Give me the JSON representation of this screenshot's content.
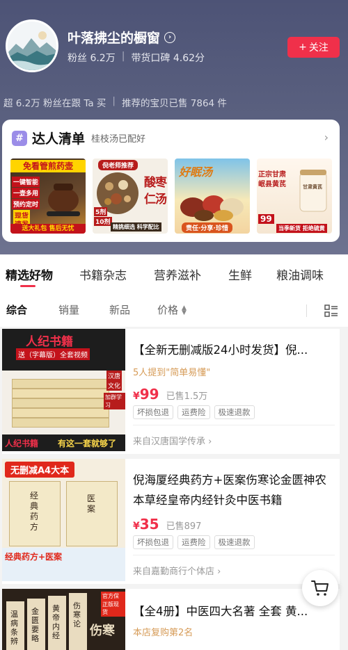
{
  "shop": {
    "name": "叶落拂尘的橱窗",
    "fans": "粉丝 6.2万",
    "rating": "带货口碑 4.62分",
    "follow_label": "关注",
    "stats_left": "超 6.2万 粉丝在跟 Ta 买",
    "stats_right": "推荐的宝贝已售 7864 件"
  },
  "curated": {
    "title": "达人清单",
    "subtitle": "桂枝汤已配好",
    "thumbs": [
      {
        "texts": [
          "免看管煎药壶",
          "一键智能",
          "一壶多用",
          "预约定时",
          "现货",
          "速发",
          "送大礼包 售后无忧"
        ]
      },
      {
        "texts": [
          "倪老师推荐",
          "酸",
          "枣",
          "仁",
          "汤",
          "5剂",
          "10剂",
          "精挑细选 科学配比"
        ]
      },
      {
        "texts": [
          "好眠汤",
          "责任·分享·珍惜"
        ]
      },
      {
        "texts": [
          "正宗甘肃",
          "岷县黄芪",
          "甘肃黄芪",
          "99",
          "当季新货 拒绝硫黄"
        ]
      }
    ]
  },
  "tabs": [
    "精选好物",
    "书籍杂志",
    "营养滋补",
    "生鲜",
    "粮油调味"
  ],
  "sorts": [
    "综合",
    "销量",
    "新品",
    "价格"
  ],
  "products": [
    {
      "title": "【全新无删减版24小时发货】倪...",
      "hint": "5人提到\"简单易懂\"",
      "price_symbol": "¥",
      "price": "99",
      "sold": "已售1.5万",
      "tags": [
        "坏损包退",
        "运费险",
        "极速退款"
      ],
      "shop": "来自汉唐国学传承",
      "img_texts": [
        "人纪书籍",
        "送（字幕版）全套视频",
        "汉唐",
        "文化",
        "加群学习",
        "人纪书籍",
        "有这一套就够了"
      ]
    },
    {
      "title": "倪海厦经典药方+医案伤寒论金匮神农本草经皇帝内经针灸中医书籍",
      "price_symbol": "¥",
      "price": "35",
      "sold": "已售897",
      "tags": [
        "坏损包退",
        "运费险",
        "极速退款"
      ],
      "shop": "来自嘉勤商行个体店",
      "img_texts": [
        "无删减A4大本",
        "经典药方",
        "医案",
        "经典药方+医案"
      ]
    },
    {
      "title": "【全4册】中医四大名著 全套 黄...",
      "hint": "本店复购第2名",
      "img_texts": [
        "官方保障",
        "正版现货",
        "温病条辨",
        "金匮要略",
        "黄帝内经",
        "伤寒论",
        "伤寒"
      ]
    }
  ],
  "colors": {
    "accent": "#f0304a",
    "header_bg": "#4d5376",
    "hint": "#d69b57"
  }
}
